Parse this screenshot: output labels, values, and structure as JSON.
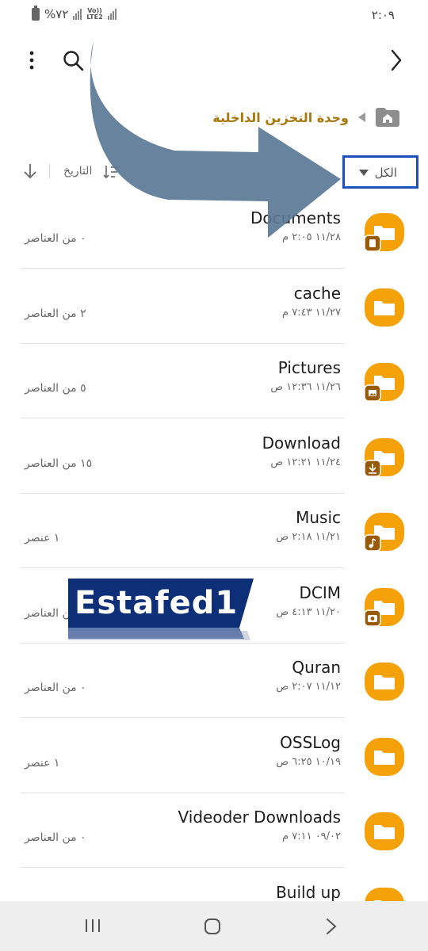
{
  "status_bar": {
    "battery": "%٧٢",
    "network_top": "Vo))",
    "network_bottom": "LTE2",
    "time": "٢:٠٩"
  },
  "toolbar": {
    "more_icon": "more-vertical-icon",
    "search_icon": "search-icon",
    "back_icon": "chevron-right-icon"
  },
  "breadcrumb": {
    "label": "وحدة التخزين الداخلية",
    "home_icon": "home-folder-icon"
  },
  "sort": {
    "label": "التاريخ",
    "filter_label": "الكل"
  },
  "colors": {
    "folder": "#f5a20a",
    "folder_badge": "#9a5a05",
    "breadcrumb": "#a6770a",
    "highlight_box": "#1f4fb8",
    "arrow": "#5b7896"
  },
  "files": [
    {
      "name": "Documents",
      "date": "١١/٢٨ ٢:٠٥ م",
      "count": "٠ من العناصر",
      "badge": "document"
    },
    {
      "name": "cache",
      "date": "١١/٢٧ ٧:٤٣ م",
      "count": "٢ من العناصر",
      "badge": ""
    },
    {
      "name": "Pictures",
      "date": "١١/٢٦ ١٢:٣٦ ص",
      "count": "٥ من العناصر",
      "badge": "image"
    },
    {
      "name": "Download",
      "date": "١١/٢٤ ١٢:٢١ ص",
      "count": "١٥ من العناصر",
      "badge": "download"
    },
    {
      "name": "Music",
      "date": "١١/٢١ ٢:١٨ ص",
      "count": "١ عنصر",
      "badge": "music"
    },
    {
      "name": "DCIM",
      "date": "١١/٢٠ ٤:١٣ ص",
      "count": "من العناصر",
      "badge": "camera"
    },
    {
      "name": "Quran",
      "date": "١١/١٢ ٢:٠٧ ص",
      "count": "٠ من العناصر",
      "badge": ""
    },
    {
      "name": "OSSLog",
      "date": "١٠/١٩ ٦:٢٥ ص",
      "count": "١ عنصر",
      "badge": ""
    },
    {
      "name": "Videoder Downloads",
      "date": "٠٩/٠٢ ٧:١١ م",
      "count": "٠ من العناصر",
      "badge": ""
    },
    {
      "name": "Build up",
      "date": "",
      "count": "",
      "badge": ""
    }
  ],
  "watermark": {
    "text": "Estafed1"
  },
  "navbar": {
    "recent_icon": "recent-apps-icon",
    "home_icon": "home-button-icon",
    "back_icon": "back-chevron-icon"
  }
}
